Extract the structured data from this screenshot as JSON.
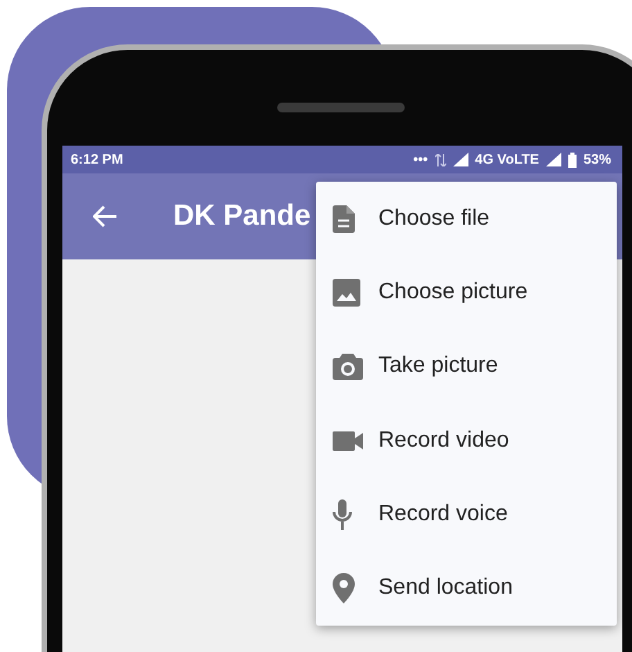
{
  "status_bar": {
    "time": "6:12 PM",
    "dots": "•••",
    "network": "4G VoLTE",
    "battery": "53%"
  },
  "app_bar": {
    "title": "DK Pande"
  },
  "menu": {
    "items": [
      {
        "kind": "file",
        "label": "Choose file"
      },
      {
        "kind": "image",
        "label": "Choose picture"
      },
      {
        "kind": "camera",
        "label": "Take picture"
      },
      {
        "kind": "video",
        "label": "Record video"
      },
      {
        "kind": "mic",
        "label": "Record voice"
      },
      {
        "kind": "pin",
        "label": "Send location"
      }
    ]
  }
}
